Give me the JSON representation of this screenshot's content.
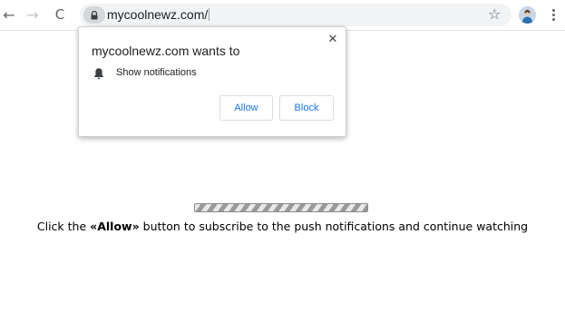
{
  "browser": {
    "url_text": "mycoolnewz.com/",
    "back_glyph": "←",
    "forward_glyph": "→",
    "reload_glyph": "C",
    "star_glyph": "☆",
    "icons": [
      "back-arrow-icon",
      "forward-arrow-icon",
      "reload-icon",
      "lock-icon",
      "star-icon",
      "avatar",
      "more-menu-icon"
    ]
  },
  "notification_prompt": {
    "title": "mycoolnewz.com wants to",
    "close_glyph": "✕",
    "permission_label": "Show notifications",
    "allow_label": "Allow",
    "block_label": "Block",
    "button_text_color": "#1a73e8"
  },
  "page": {
    "progress_state": "indeterminate",
    "message_prefix": "Click the ",
    "message_emphasis": "«Allow»",
    "message_suffix": " button to subscribe to the push notifications and continue watching"
  }
}
